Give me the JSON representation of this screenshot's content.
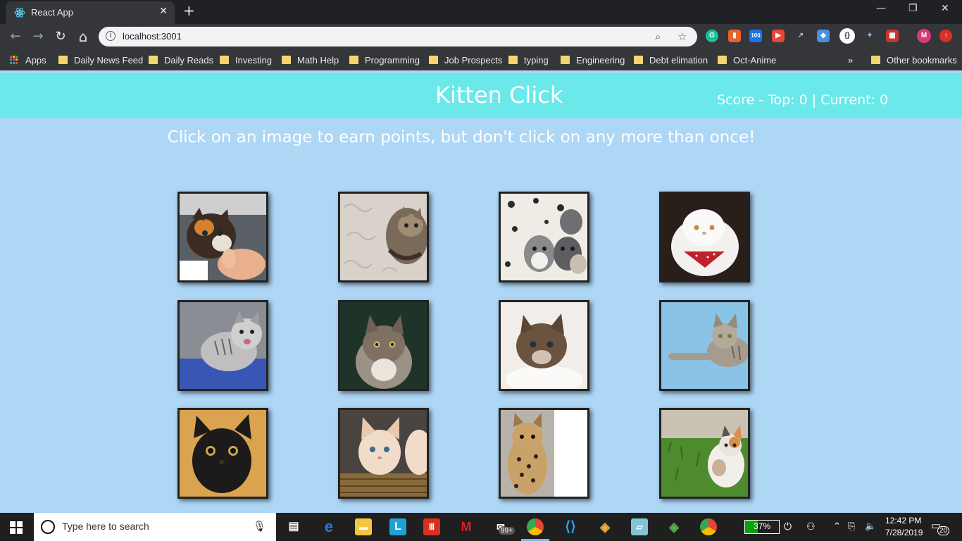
{
  "browser": {
    "tab_title": "React App",
    "tab_close": "✕",
    "new_tab": "+",
    "url": "localhost:3001",
    "window_controls": {
      "minimize": "—",
      "restore": "❐",
      "close": "✕"
    },
    "nav": {
      "back": "←",
      "forward": "→",
      "reload": "↻",
      "home": "⌂"
    },
    "extension_badge": "100",
    "profile_initial": "M"
  },
  "bookmarks": {
    "apps_label": "Apps",
    "items": [
      "Daily News Feed",
      "Daily Reads",
      "Investing",
      "Math Help",
      "Programming",
      "Job Prospects",
      "typing",
      "Engineering",
      "Debt elimation",
      "Oct-Anime"
    ],
    "overflow": "»",
    "other": "Other bookmarks"
  },
  "app": {
    "title": "Kitten Click",
    "score_text": "Score - Top: 0 | Current: 0",
    "instructions": "Click on an image to earn points, but don't click on any more than once!",
    "colors": {
      "header": "#6ae8ea",
      "background": "#aed6f5"
    },
    "kittens": [
      "calico kitten held in hand",
      "tabby kitten on fluffy rug",
      "kittens on patterned blanket",
      "white persian with red bandana",
      "grey tabby kitten meowing",
      "fluffy tabby kitten",
      "brown kitten peeking",
      "tabby kitten on blue",
      "black kitten",
      "ginger kittens in basket",
      "spotted ocelot kitten",
      "calico kitten on grass"
    ]
  },
  "taskbar": {
    "search_placeholder": "Type here to search",
    "mail_badge": "99+",
    "battery": "37%",
    "battery_level": 0.37,
    "time": "12:42 PM",
    "date": "7/28/2019",
    "notifications": "20"
  }
}
